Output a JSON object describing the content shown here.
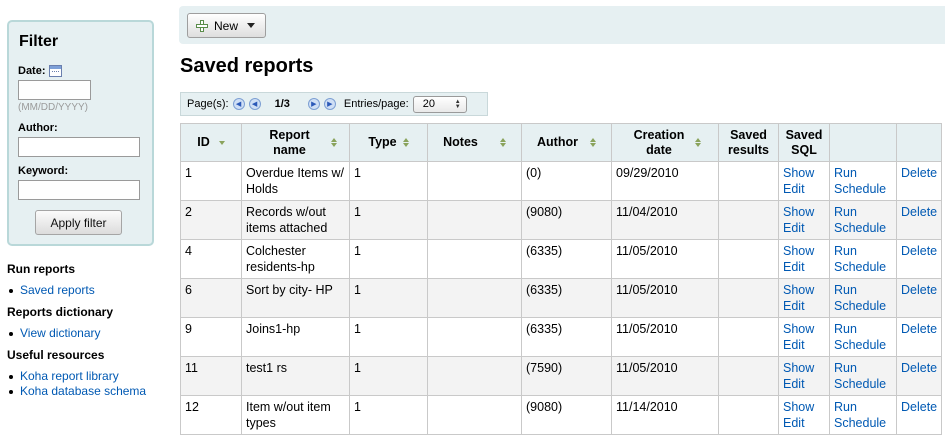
{
  "sidebar": {
    "filter": {
      "title": "Filter",
      "date_label": "Date:",
      "date_value": "",
      "date_hint": "(MM/DD/YYYY)",
      "author_label": "Author:",
      "author_value": "",
      "keyword_label": "Keyword:",
      "keyword_value": "",
      "apply_label": "Apply filter"
    },
    "nav": [
      {
        "heading": "Run reports",
        "items": [
          "Saved reports"
        ]
      },
      {
        "heading": "Reports dictionary",
        "items": [
          "View dictionary"
        ]
      },
      {
        "heading": "Useful resources",
        "items": [
          "Koha report library",
          "Koha database schema"
        ]
      }
    ]
  },
  "toolbar": {
    "new_label": "New"
  },
  "page": {
    "title": "Saved reports"
  },
  "pager": {
    "pages_label": "Page(s):",
    "count": "1/3",
    "entries_label": "Entries/page:",
    "entries_value": "20"
  },
  "table": {
    "columns": [
      "ID",
      "Report name",
      "Type",
      "Notes",
      "Author",
      "Creation date",
      "Saved results",
      "Saved SQL",
      "",
      ""
    ],
    "rows": [
      {
        "id": "1",
        "name": "Overdue Items w/ Holds",
        "type": "1",
        "notes": "",
        "author": "(0)",
        "date": "09/29/2010",
        "results": "",
        "show": "Show",
        "edit": "Edit",
        "run": "Run",
        "schedule": "Schedule",
        "delete": "Delete"
      },
      {
        "id": "2",
        "name": "Records w/out items attached",
        "type": "1",
        "notes": "",
        "author": "(9080)",
        "date": "11/04/2010",
        "results": "",
        "show": "Show",
        "edit": "Edit",
        "run": "Run",
        "schedule": "Schedule",
        "delete": "Delete"
      },
      {
        "id": "4",
        "name": "Colchester residents-hp",
        "type": "1",
        "notes": "",
        "author": "(6335)",
        "date": "11/05/2010",
        "results": "",
        "show": "Show",
        "edit": "Edit",
        "run": "Run",
        "schedule": "Schedule",
        "delete": "Delete"
      },
      {
        "id": "6",
        "name": "Sort by city- HP",
        "type": "1",
        "notes": "",
        "author": "(6335)",
        "date": "11/05/2010",
        "results": "",
        "show": "Show",
        "edit": "Edit",
        "run": "Run",
        "schedule": "Schedule",
        "delete": "Delete"
      },
      {
        "id": "9",
        "name": "Joins1-hp",
        "type": "1",
        "notes": "",
        "author": "(6335)",
        "date": "11/05/2010",
        "results": "",
        "show": "Show",
        "edit": "Edit",
        "run": "Run",
        "schedule": "Schedule",
        "delete": "Delete"
      },
      {
        "id": "11",
        "name": "test1 rs",
        "type": "1",
        "notes": "",
        "author": "(7590)",
        "date": "11/05/2010",
        "results": "",
        "show": "Show",
        "edit": "Edit",
        "run": "Run",
        "schedule": "Schedule",
        "delete": "Delete"
      },
      {
        "id": "12",
        "name": "Item w/out item types",
        "type": "1",
        "notes": "",
        "author": "(9080)",
        "date": "11/14/2010",
        "results": "",
        "show": "Show",
        "edit": "Edit",
        "run": "Run",
        "schedule": "Schedule",
        "delete": "Delete"
      }
    ]
  }
}
